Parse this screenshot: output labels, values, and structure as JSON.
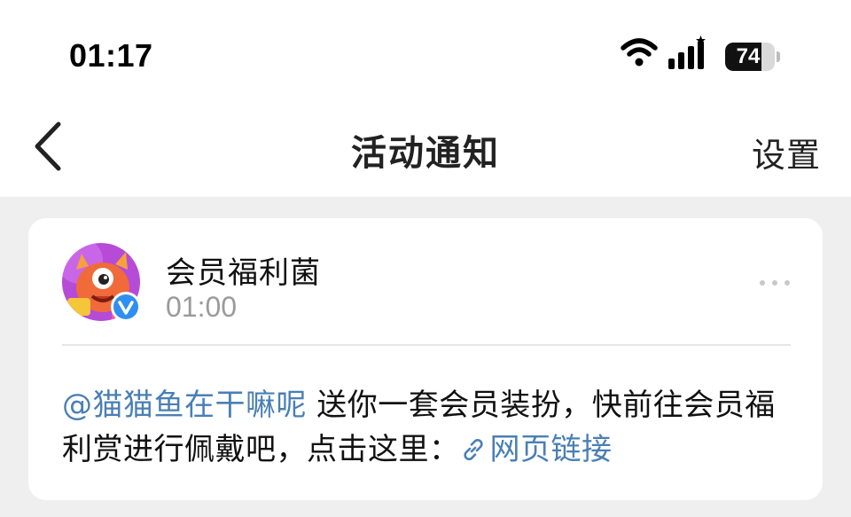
{
  "status_bar": {
    "time": "01:17",
    "battery_text": "74",
    "battery_level_percent": 74
  },
  "nav": {
    "title": "活动通知",
    "settings_label": "设置",
    "back_icon": "chevron-left-icon"
  },
  "card": {
    "sender": "会员福利菌",
    "time": "01:00",
    "more_icon": "more-dots-icon",
    "verified_icon": "verified-v-icon",
    "message": {
      "mention": "@猫猫鱼在干嘛呢",
      "text": " 送你一套会员装扮，快前往会员福利赏进行佩戴吧，点击这里：",
      "link_label": "网页链接",
      "link_icon": "link-icon"
    }
  },
  "colors": {
    "link": "#4a7fb5",
    "background": "#efefef",
    "card": "#ffffff",
    "secondary_text": "#9a9a9a",
    "verified": "#2f8ff0"
  }
}
